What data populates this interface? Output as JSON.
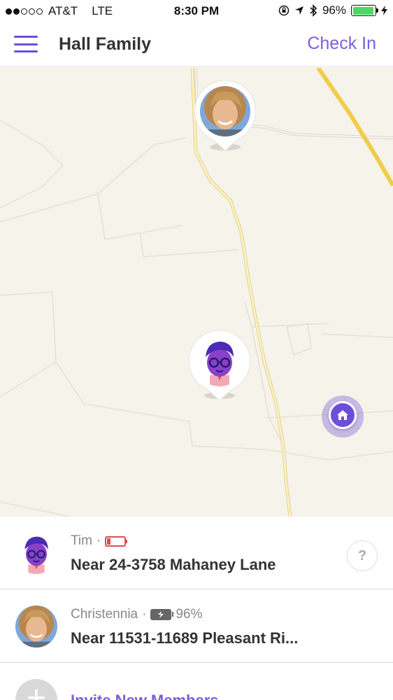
{
  "status_bar": {
    "carrier": "AT&T",
    "network": "LTE",
    "time": "8:30 PM",
    "battery_percent": "96%",
    "battery_level": 0.96,
    "icons": [
      "orientation-lock-icon",
      "location-arrow-icon",
      "bluetooth-icon",
      "battery-icon",
      "charging-bolt-icon"
    ]
  },
  "nav": {
    "title": "Hall Family",
    "check_in_label": "Check In"
  },
  "map": {
    "colors": {
      "background": "#f6f3ea",
      "road": "#f1e0a0",
      "highway": "#f5d75c",
      "accent": "#6e4ed9"
    }
  },
  "members": [
    {
      "name": "Tim",
      "location": "Near 24-3758 Mahaney Lane",
      "battery_status": "low",
      "avatar": "cartoon-avatar"
    },
    {
      "name": "Christennia",
      "location": "Near 11531-11689 Pleasant Ri...",
      "battery_percent": "96%",
      "battery_status": "charging",
      "avatar": "photo-avatar"
    }
  ],
  "invite": {
    "label": "Invite New Members"
  }
}
